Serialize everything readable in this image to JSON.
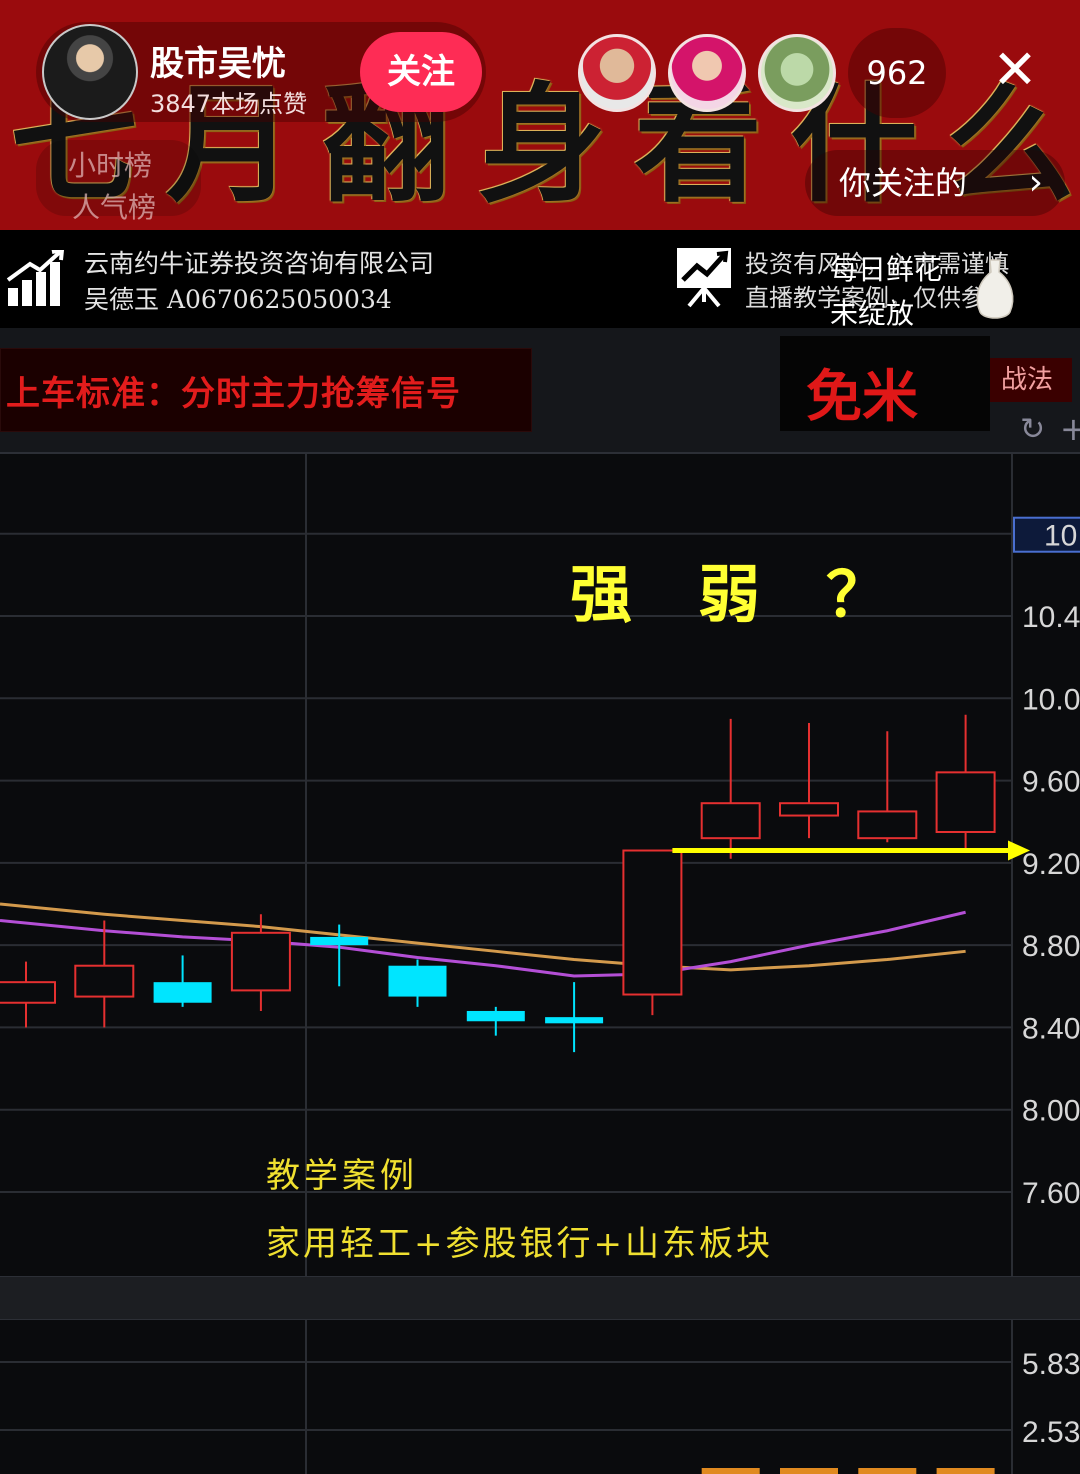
{
  "live": {
    "banner_title": "七月翻身看什么",
    "host_name": "股市吴忧",
    "host_likes": "3847本场点赞",
    "follow_label": "关注",
    "viewer_count": "962",
    "close_icon": "close-icon",
    "hourly_rank": "小时榜",
    "popularity_rank": "人气榜",
    "follow_link": "你关注的",
    "follow_link_icon": "chevron-right-icon"
  },
  "info": {
    "company": "云南约牛证券投资咨询有限公司",
    "license": "吴德玉 A0670625050034",
    "risk_line1": "投资有风险，入市需谨慎",
    "risk_line2": "直播教学案例，仅供参考",
    "gift_line1": "每日鲜花",
    "gift_line2": "未绽放"
  },
  "toolbar": {
    "signal_label": "上车标准：分时主力抢筹信号",
    "tactics_tab": "战法",
    "free_rice": "免米"
  },
  "chart_data": {
    "type": "candlestick",
    "y_ticks": [
      "10.4",
      "10.0",
      "9.60",
      "9.20",
      "8.80",
      "8.40",
      "8.00",
      "7.60"
    ],
    "top_tick_partial": "10.",
    "ylim": [
      7.3,
      11.4
    ],
    "candles": [
      {
        "open": 8.52,
        "close": 8.62,
        "high": 8.72,
        "low": 8.4,
        "color": "red"
      },
      {
        "open": 8.55,
        "close": 8.7,
        "high": 8.92,
        "low": 8.4,
        "color": "red"
      },
      {
        "open": 8.62,
        "close": 8.52,
        "high": 8.75,
        "low": 8.5,
        "color": "cyan"
      },
      {
        "open": 8.58,
        "close": 8.86,
        "high": 8.95,
        "low": 8.48,
        "color": "red"
      },
      {
        "open": 8.84,
        "close": 8.8,
        "high": 8.9,
        "low": 8.6,
        "color": "cyan"
      },
      {
        "open": 8.7,
        "close": 8.55,
        "high": 8.73,
        "low": 8.5,
        "color": "cyan"
      },
      {
        "open": 8.48,
        "close": 8.43,
        "high": 8.5,
        "low": 8.36,
        "color": "cyan"
      },
      {
        "open": 8.45,
        "close": 8.42,
        "high": 8.62,
        "low": 8.28,
        "color": "cyan"
      },
      {
        "open": 8.56,
        "close": 9.26,
        "high": 9.26,
        "low": 8.46,
        "color": "red"
      },
      {
        "open": 9.32,
        "close": 9.49,
        "high": 9.9,
        "low": 9.22,
        "color": "red"
      },
      {
        "open": 9.43,
        "close": 9.49,
        "high": 9.88,
        "low": 9.32,
        "color": "red"
      },
      {
        "open": 9.32,
        "close": 9.45,
        "high": 9.84,
        "low": 9.3,
        "color": "red"
      },
      {
        "open": 9.35,
        "close": 9.64,
        "high": 9.92,
        "low": 9.25,
        "color": "red"
      }
    ],
    "ma_orange": [
      9.0,
      8.95,
      8.92,
      8.89,
      8.85,
      8.81,
      8.77,
      8.73,
      8.7,
      8.68,
      8.7,
      8.73,
      8.77
    ],
    "ma_purple": [
      8.92,
      8.87,
      8.84,
      8.82,
      8.79,
      8.74,
      8.7,
      8.65,
      8.66,
      8.72,
      8.8,
      8.87,
      8.96
    ],
    "support_level": 9.26,
    "volume_ticks": [
      "5.83",
      "2.53"
    ],
    "annotation_question": "强　弱　？",
    "annotation_case": "教学案例",
    "annotation_sectors": "家用轻工+参股银行+山东板块",
    "colors": {
      "up": "#e53030",
      "down": "#00e5ff",
      "ma1": "#d39a4c",
      "ma2": "#b44fd6",
      "support": "#ffff00"
    }
  }
}
